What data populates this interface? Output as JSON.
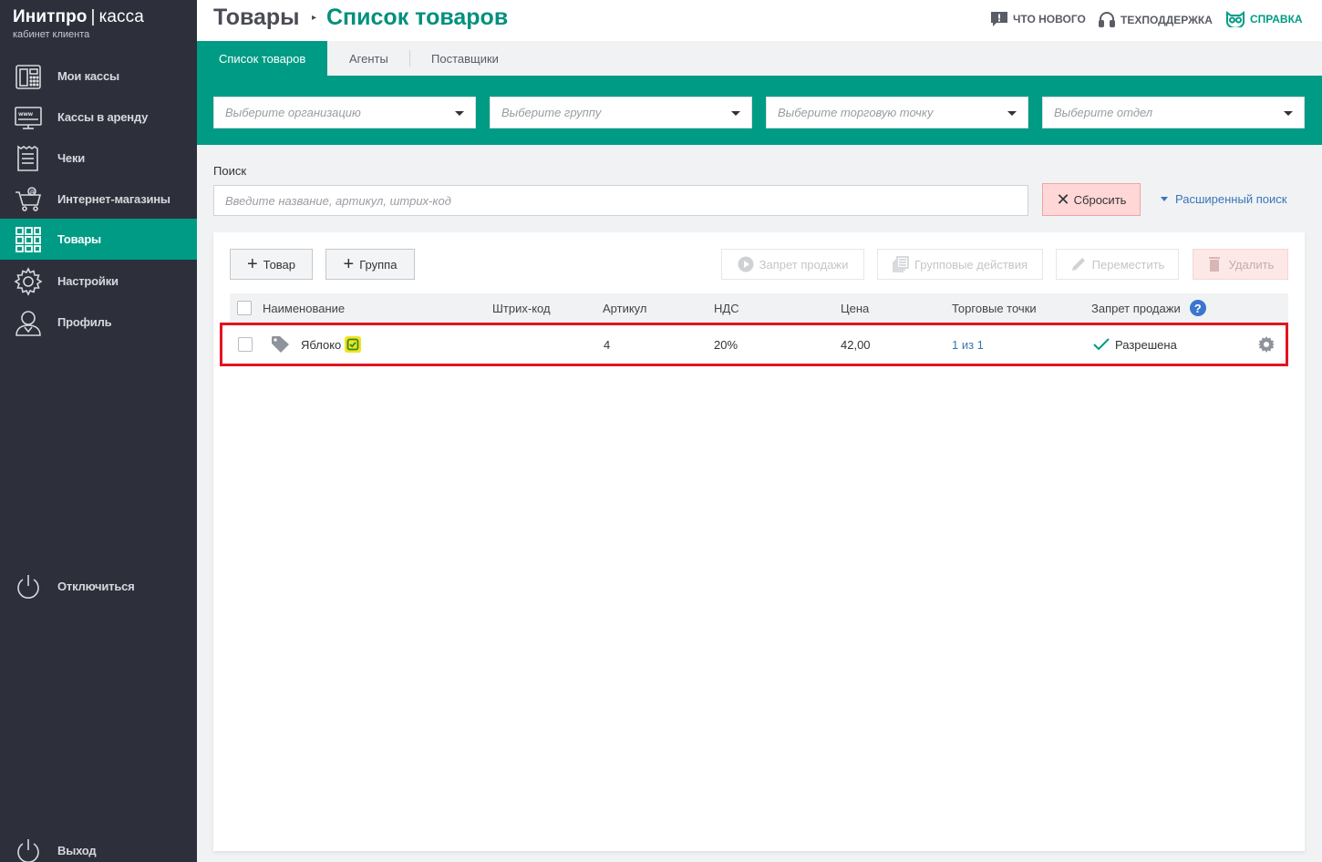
{
  "app": {
    "brand_bold": "Инитпро",
    "brand_sep": "|",
    "brand_light": "касса",
    "brand_sub": "кабинет клиента"
  },
  "sidebar": {
    "items": [
      {
        "label": "Мои кассы",
        "icon": "cash-register-icon"
      },
      {
        "label": "Кассы в аренду",
        "icon": "www-monitor-icon"
      },
      {
        "label": "Чеки",
        "icon": "receipt-icon"
      },
      {
        "label": "Интернет-магазины",
        "icon": "shopping-cart-icon"
      },
      {
        "label": "Товары",
        "icon": "grid-icon",
        "active": true
      },
      {
        "label": "Настройки",
        "icon": "gear-icon"
      },
      {
        "label": "Профиль",
        "icon": "user-icon"
      }
    ],
    "disconnect": "Отключиться",
    "logout": "Выход"
  },
  "header": {
    "title": "Товары",
    "subtitle": "Список товаров",
    "whats_new": "ЧТО НОВОГО",
    "support": "ТЕХПОДДЕРЖКА",
    "help": "СПРАВКА"
  },
  "tabs": [
    {
      "label": "Список товаров",
      "active": true
    },
    {
      "label": "Агенты"
    },
    {
      "label": "Поставщики"
    }
  ],
  "filters": {
    "organization": "Выберите организацию",
    "group": "Выберите группу",
    "point": "Выберите торговую точку",
    "department": "Выберите отдел"
  },
  "search": {
    "label": "Поиск",
    "placeholder": "Введите название, артикул, штрих-код",
    "reset": "Сбросить",
    "advanced": "Расширенный поиск"
  },
  "toolbar": {
    "add_item": "Товар",
    "add_group": "Группа",
    "ban_sale": "Запрет продажи",
    "group_actions": "Групповые действия",
    "move": "Переместить",
    "delete": "Удалить"
  },
  "table": {
    "columns": {
      "name": "Наименование",
      "barcode": "Штрих-код",
      "article": "Артикул",
      "vat": "НДС",
      "price": "Цена",
      "points": "Торговые точки",
      "ban": "Запрет продажи",
      "help": "?"
    },
    "rows": [
      {
        "name": "Яблоко",
        "barcode": "",
        "article": "4",
        "vat": "20%",
        "price": "42,00",
        "points": "1 из 1",
        "ban": "Разрешена"
      }
    ]
  },
  "colors": {
    "sidebar_bg": "#2d2f3b",
    "accent": "#009b85",
    "highlight": "#e3141f",
    "link": "#3a76b7"
  }
}
